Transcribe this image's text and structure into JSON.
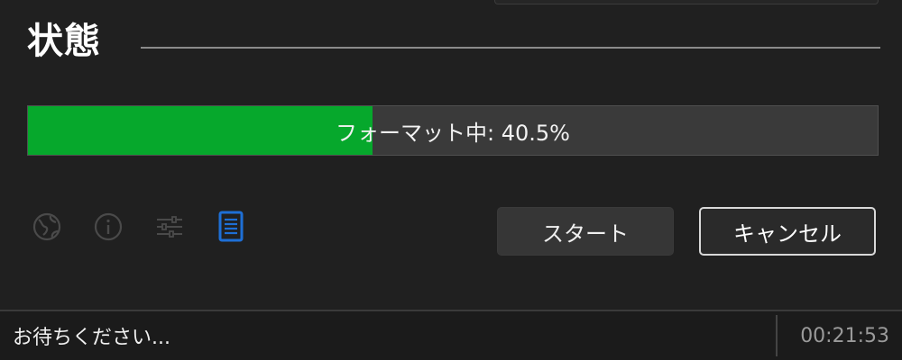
{
  "section": {
    "title": "状態"
  },
  "progress": {
    "label": "フォーマット中: 40.5%",
    "value": 0.405,
    "fill_color": "#06a82c"
  },
  "toolbar": {
    "icons": [
      {
        "name": "globe-icon",
        "active": false
      },
      {
        "name": "info-icon",
        "active": false
      },
      {
        "name": "sliders-icon",
        "active": false
      },
      {
        "name": "log-icon",
        "active": true
      }
    ],
    "active_color": "#1e6fd6",
    "inactive_color": "#4a4a4a"
  },
  "buttons": {
    "start_label": "スタート",
    "cancel_label": "キャンセル"
  },
  "status_bar": {
    "message": "お待ちください...",
    "elapsed": "00:21:53"
  }
}
